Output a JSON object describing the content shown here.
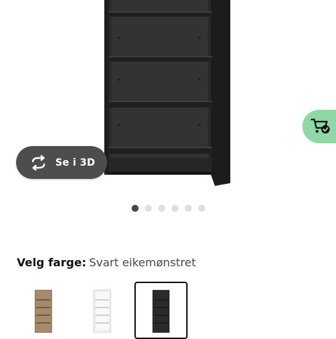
{
  "product": {
    "view3d_label": "Se i 3D",
    "carousel": {
      "total": 6,
      "active_index": 0
    }
  },
  "color_picker": {
    "label": "Velg farge:",
    "selected_value": "Svart eikemønstret",
    "swatches": [
      {
        "color": "#a58a6b",
        "selected": false
      },
      {
        "color": "#ffffff",
        "selected": false
      },
      {
        "color": "#2c2c2c",
        "selected": true
      }
    ]
  },
  "icons": {
    "view3d": "rotate-3d-icon",
    "cart": "add-to-cart-icon"
  },
  "colors": {
    "view3d_bg": "#4d4d4d",
    "cart_fab_bg": "#8fd8a6",
    "dot_active": "#484848",
    "dot_inactive": "#dfdfdf"
  }
}
